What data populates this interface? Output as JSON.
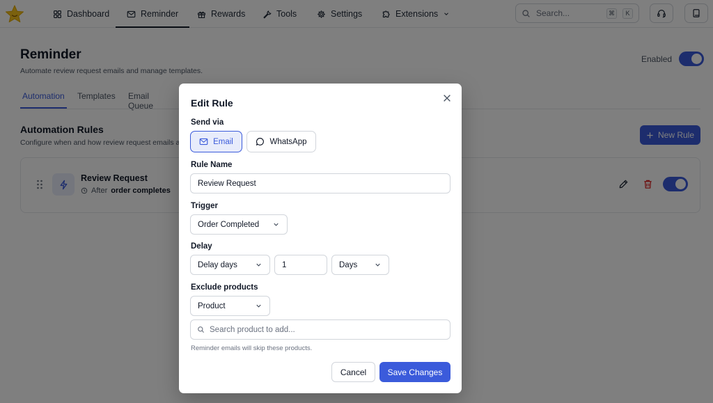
{
  "nav": {
    "items": [
      {
        "label": "Dashboard",
        "icon": "grid-icon"
      },
      {
        "label": "Reminder",
        "icon": "mail-icon"
      },
      {
        "label": "Rewards",
        "icon": "gift-icon"
      },
      {
        "label": "Tools",
        "icon": "wrench-icon"
      },
      {
        "label": "Settings",
        "icon": "gear-icon"
      },
      {
        "label": "Extensions",
        "icon": "puzzle-icon"
      }
    ],
    "active": "Reminder",
    "search_placeholder": "Search...",
    "kbd_cmd": "⌘",
    "kbd_k": "K"
  },
  "page": {
    "title": "Reminder",
    "subtitle": "Automate review request emails and manage templates.",
    "enabled_label": "Enabled",
    "enabled": true,
    "tabs": [
      "Automation",
      "Templates",
      "Email Queue"
    ],
    "active_tab": "Automation"
  },
  "rules_section": {
    "title": "Automation Rules",
    "subtitle": "Configure when and how review request emails are sent.",
    "new_rule_label": "New Rule",
    "rule": {
      "name": "Review Request",
      "after_label": "After",
      "trigger": "order completes",
      "enabled": true
    }
  },
  "modal": {
    "title": "Edit Rule",
    "send_via_label": "Send via",
    "channels": [
      {
        "label": "Email",
        "icon": "mail-icon",
        "selected": true
      },
      {
        "label": "WhatsApp",
        "icon": "chat-bubble-icon",
        "selected": false
      }
    ],
    "rule_name_label": "Rule Name",
    "rule_name_value": "Review Request",
    "trigger_label": "Trigger",
    "trigger_value": "Order Completed",
    "delay_label": "Delay",
    "delay_type": "Delay days",
    "delay_amount": "1",
    "delay_unit": "Days",
    "exclude_label": "Exclude products",
    "exclude_type": "Product",
    "search_placeholder": "Search product to add...",
    "hint": "Reminder emails will skip these products.",
    "cancel_label": "Cancel",
    "save_label": "Save Changes"
  },
  "colors": {
    "accent": "#3b5bdb",
    "accent_soft": "#e8ecfb",
    "danger": "#dc2626",
    "logo": "#f6c21c"
  }
}
